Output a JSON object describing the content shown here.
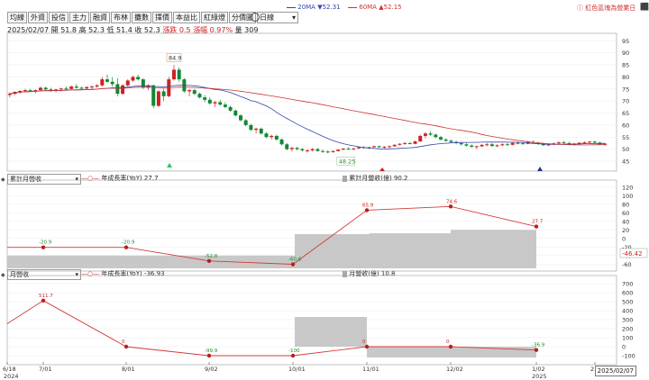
{
  "toolbar": {
    "buttons": [
      "均線",
      "外資",
      "投信",
      "主力",
      "融資",
      "布林",
      "攤數",
      "擇價",
      "本益比",
      "紅綠燈",
      "分價圖"
    ],
    "period": "日線"
  },
  "ma_legend": {
    "ma20": "20MA ▼52.31",
    "ma60": "60MA ▲52.15",
    "note": "ⓘ 紅色區塊為營業日",
    "ma20_color": "#3344aa",
    "ma60_color": "#cc3333"
  },
  "quote": {
    "date": "2025/02/07",
    "open": "開 51.8",
    "high": "高 52.3",
    "low": "低 51.4",
    "close": "收 52.3",
    "change": "漲跌 0.5",
    "pct": "漲幅 0.97%",
    "volume": "量 309"
  },
  "colors": {
    "up": "#cc2222",
    "down": "#118833",
    "area": "#c8c8c8",
    "line": "#d43b3b"
  },
  "panels": {
    "p2_select": "累計月營收",
    "p2_yoy": "年成長率(YoY) 27.7",
    "p2_rev": "累計月營收(億) 90.2",
    "p2_value": "-46.42",
    "p3_select": "月營收",
    "p3_yoy": "年成長率(YoY) -36.93",
    "p3_rev": "月營收(億) 10.8"
  },
  "chart_data": [
    {
      "type": "candlestick",
      "y_ticks": [
        95,
        90,
        85,
        80,
        75,
        70,
        65,
        60,
        55,
        50,
        45
      ],
      "ylim": [
        42,
        97
      ],
      "annotations": [
        "84.9",
        "48.25"
      ],
      "candles": [
        [
          72.5,
          73.5,
          71.5,
          73
        ],
        [
          73,
          74,
          72.5,
          73.8
        ],
        [
          73.8,
          74.5,
          73,
          74.2
        ],
        [
          74.2,
          75,
          73.5,
          74.5
        ],
        [
          74.5,
          75,
          73.8,
          74
        ],
        [
          74,
          74.8,
          73.2,
          74.5
        ],
        [
          74.5,
          76,
          74,
          75.5
        ],
        [
          75.5,
          76,
          74.2,
          74.8
        ],
        [
          74.8,
          75.5,
          73.8,
          74.2
        ],
        [
          74.2,
          75,
          73.5,
          74.8
        ],
        [
          74.8,
          75.5,
          74,
          75.2
        ],
        [
          75.2,
          76,
          74.5,
          75
        ],
        [
          75,
          76.5,
          74.5,
          76
        ],
        [
          76,
          77,
          75.2,
          75.5
        ],
        [
          75.5,
          76,
          74.5,
          75.2
        ],
        [
          75.2,
          76,
          74.8,
          75.8
        ],
        [
          75.8,
          76.5,
          75,
          76
        ],
        [
          76,
          77,
          75.5,
          76.5
        ],
        [
          76.5,
          80,
          76,
          79
        ],
        [
          79,
          81,
          77.5,
          78
        ],
        [
          78,
          80,
          76,
          77
        ],
        [
          77,
          79.5,
          72,
          73
        ],
        [
          73,
          77,
          72.5,
          76.5
        ],
        [
          76.5,
          79,
          76,
          78.5
        ],
        [
          78.5,
          80.5,
          78,
          80
        ],
        [
          80,
          81,
          78.5,
          79
        ],
        [
          79,
          79.5,
          75,
          75.5
        ],
        [
          75.5,
          77,
          74.5,
          76.5
        ],
        [
          76.5,
          76.8,
          67,
          68
        ],
        [
          68,
          74.5,
          67.5,
          74
        ],
        [
          74,
          75,
          70,
          72
        ],
        [
          72,
          80,
          71.5,
          79
        ],
        [
          79,
          84.9,
          78.5,
          83
        ],
        [
          83,
          84,
          78,
          79
        ],
        [
          79,
          79.5,
          73.5,
          74
        ],
        [
          74,
          75,
          72,
          74.5
        ],
        [
          74.5,
          75,
          72.5,
          73
        ],
        [
          73,
          73.5,
          71,
          71.5
        ],
        [
          71.5,
          72.5,
          69.5,
          70.5
        ],
        [
          70.5,
          71.5,
          68.5,
          69
        ],
        [
          69,
          70,
          67.5,
          69.5
        ],
        [
          69.5,
          70.5,
          68,
          68.5
        ],
        [
          68.5,
          69.5,
          67,
          67.5
        ],
        [
          67.5,
          68,
          65.5,
          66
        ],
        [
          66,
          66.5,
          63.5,
          64
        ],
        [
          64,
          64.5,
          61.5,
          62
        ],
        [
          62,
          62.5,
          59.5,
          60
        ],
        [
          60,
          60.5,
          57.5,
          58
        ],
        [
          58,
          59,
          56.5,
          58.5
        ],
        [
          58.5,
          59,
          56,
          56.5
        ],
        [
          56.5,
          57,
          54.5,
          55
        ],
        [
          55,
          56,
          54,
          55.5
        ],
        [
          55.5,
          56,
          53.5,
          54
        ],
        [
          54,
          54.5,
          51.5,
          52
        ],
        [
          52,
          52.5,
          49.5,
          50
        ],
        [
          50,
          51,
          49,
          50.5
        ],
        [
          50.5,
          51,
          49.5,
          50
        ],
        [
          50,
          50.5,
          49,
          49.5
        ],
        [
          49.5,
          50,
          48.5,
          49.5
        ],
        [
          49.5,
          50.5,
          49,
          50
        ],
        [
          50,
          50.5,
          49,
          49.2
        ],
        [
          49.2,
          49.8,
          48.5,
          49
        ],
        [
          49,
          49.5,
          48.25,
          48.8
        ],
        [
          48.8,
          49.5,
          48.5,
          49.2
        ],
        [
          49.2,
          50,
          49,
          49.8
        ],
        [
          49.8,
          50.5,
          49.5,
          50.2
        ],
        [
          50.2,
          50.8,
          49.8,
          50
        ],
        [
          50,
          50.5,
          49.5,
          50.3
        ],
        [
          50.3,
          51,
          50,
          50.8
        ],
        [
          50.8,
          51.2,
          50.2,
          50.5
        ],
        [
          50.5,
          51,
          50,
          50.8
        ],
        [
          50.8,
          51.5,
          50.5,
          51.2
        ],
        [
          51.2,
          51.5,
          50.5,
          50.8
        ],
        [
          50.8,
          51.2,
          50.2,
          51
        ],
        [
          51,
          51.5,
          50.5,
          51.2
        ],
        [
          51.2,
          52,
          51,
          51.8
        ],
        [
          51.8,
          52.5,
          51.5,
          52.2
        ],
        [
          52.2,
          53,
          51.8,
          52.5
        ],
        [
          52.5,
          53,
          52,
          52.2
        ],
        [
          52.2,
          53.5,
          52,
          53.2
        ],
        [
          53.2,
          56,
          53,
          55.5
        ],
        [
          55.5,
          57,
          54.5,
          56.5
        ],
        [
          56.5,
          57.5,
          55.5,
          56
        ],
        [
          56,
          56.5,
          54.5,
          55
        ],
        [
          55,
          55.5,
          53.5,
          54
        ],
        [
          54,
          54.5,
          53,
          53.5
        ],
        [
          53.5,
          54,
          52.5,
          53
        ],
        [
          53,
          53.5,
          52,
          52.5
        ],
        [
          52.5,
          53,
          51.5,
          52
        ],
        [
          52,
          52.5,
          51,
          51.5
        ],
        [
          51.5,
          52,
          50.5,
          51
        ],
        [
          51,
          51.5,
          50,
          51.2
        ],
        [
          51.2,
          52,
          50.8,
          51.8
        ],
        [
          51.8,
          52.5,
          51.2,
          52
        ],
        [
          52,
          52.5,
          51,
          51.3
        ],
        [
          51.3,
          52,
          50.8,
          51.6
        ],
        [
          51.6,
          52.4,
          51.3,
          52
        ],
        [
          52,
          52.6,
          51.5,
          51.8
        ],
        [
          51.8,
          52.8,
          51.6,
          52.6
        ],
        [
          52.6,
          53.2,
          52,
          52.4
        ],
        [
          52.4,
          53,
          52,
          52.2
        ],
        [
          52.2,
          53.4,
          52,
          53
        ],
        [
          53,
          53.6,
          52.4,
          52.6
        ],
        [
          52.6,
          53,
          51.8,
          52.2
        ],
        [
          52.2,
          52.6,
          51.4,
          51.6
        ],
        [
          51.6,
          52.4,
          51.2,
          52
        ],
        [
          52,
          52.8,
          51.6,
          52.4
        ],
        [
          52.4,
          53.2,
          52,
          52.8
        ],
        [
          52.8,
          53.4,
          52.2,
          52.5
        ],
        [
          52.5,
          53,
          51.8,
          52
        ],
        [
          52,
          52.6,
          51.5,
          52.3
        ],
        [
          52.3,
          53,
          51.8,
          52.6
        ],
        [
          52.6,
          53.2,
          52.2,
          52.8
        ],
        [
          52.8,
          53.4,
          52.4,
          53.1
        ],
        [
          53.1,
          53.5,
          52.5,
          52.7
        ],
        [
          52.7,
          53.1,
          51.8,
          52
        ],
        [
          51.8,
          52.3,
          51.4,
          52.3
        ]
      ]
    },
    {
      "type": "line",
      "name": "累計月營收",
      "y_ticks": [
        120,
        100,
        80,
        60,
        40,
        20,
        0,
        -20,
        -40,
        -60
      ],
      "ylim": [
        -70,
        130
      ],
      "points": [
        {
          "x": "2024-06",
          "y": -20.9
        },
        {
          "x": "2024-07",
          "y": -20.9
        },
        {
          "x": "2024-08",
          "y": -20.9
        },
        {
          "x": "2024-09",
          "y": -52.8
        },
        {
          "x": "2024-10",
          "y": -60.6
        },
        {
          "x": "2024-11",
          "y": 65.9
        },
        {
          "x": "2024-12",
          "y": 74.6
        },
        {
          "x": "2025-01",
          "y": 27.7
        }
      ],
      "labels": [
        "-20.9",
        "-20.9",
        "-52.8",
        "-60.6",
        "65.9",
        "74.6",
        "27.7"
      ]
    },
    {
      "type": "line",
      "name": "月營收",
      "y_ticks": [
        700,
        600,
        500,
        400,
        300,
        200,
        100,
        0,
        -100
      ],
      "ylim": [
        -170,
        760
      ],
      "points": [
        {
          "x": "2024-06",
          "y": 255
        },
        {
          "x": "2024-07",
          "y": 511.7
        },
        {
          "x": "2024-08",
          "y": 0
        },
        {
          "x": "2024-09",
          "y": -99.9
        },
        {
          "x": "2024-10",
          "y": -100
        },
        {
          "x": "2024-11",
          "y": 0
        },
        {
          "x": "2024-12",
          "y": 0
        },
        {
          "x": "2025-01",
          "y": -36.9
        }
      ],
      "labels": [
        "511.7",
        "0",
        "-99.9",
        "-100",
        "0",
        "0",
        "-36.9"
      ]
    }
  ],
  "x_axis": {
    "ticks": [
      "6/18",
      "7/01",
      "8/01",
      "9/02",
      "10/01",
      "11/01",
      "12/02",
      "1/02",
      "2"
    ],
    "years": [
      "2024",
      "2025"
    ],
    "current": "2025/02/07"
  }
}
